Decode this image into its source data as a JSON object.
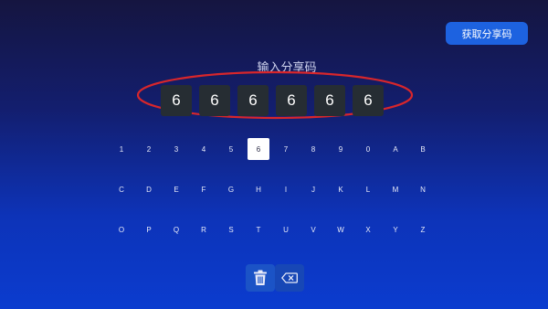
{
  "header": {
    "get_code_label": "获取分享码"
  },
  "code_entry": {
    "title": "输入分享码",
    "digits": [
      "6",
      "6",
      "6",
      "6",
      "6",
      "6"
    ]
  },
  "keyboard": {
    "selected_key": "6",
    "rows": [
      [
        "1",
        "2",
        "3",
        "4",
        "5",
        "6",
        "7",
        "8",
        "9",
        "0",
        "A",
        "B"
      ],
      [
        "C",
        "D",
        "E",
        "F",
        "G",
        "H",
        "I",
        "J",
        "K",
        "L",
        "M",
        "N"
      ],
      [
        "O",
        "P",
        "Q",
        "R",
        "S",
        "T",
        "U",
        "V",
        "W",
        "X",
        "Y",
        "Z"
      ]
    ]
  },
  "actions": {
    "clear_icon": "trash-icon",
    "backspace_icon": "backspace-icon"
  },
  "colors": {
    "accent_button": "#1d62e0",
    "code_box": "#262d33",
    "annotation": "#d8262b"
  }
}
